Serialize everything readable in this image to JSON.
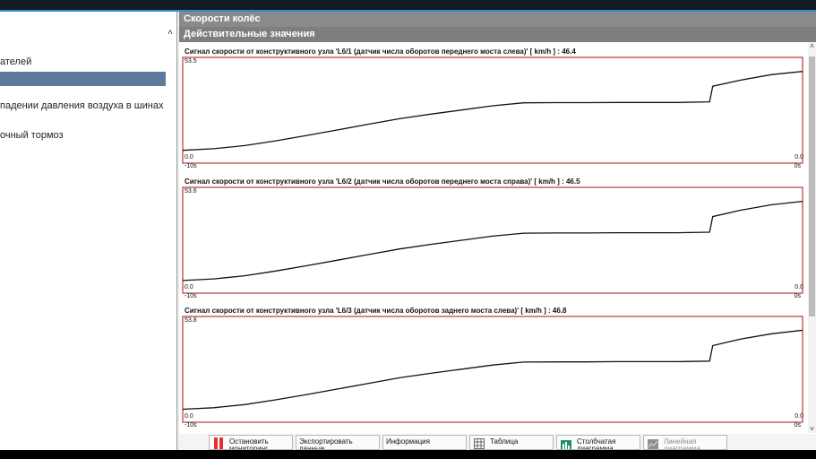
{
  "left_pane": {
    "items": [
      {
        "label": "ателей",
        "selected": false
      },
      {
        "label": "",
        "selected": true
      },
      {
        "label": "падении давления воздуха в шинах",
        "selected": false
      },
      {
        "label": "очный тормоз",
        "selected": false
      }
    ],
    "collapse_icon": "chevron-up-icon"
  },
  "header": {
    "title": "Скорости колёс",
    "subtitle": "Действительные значения"
  },
  "charts": [
    {
      "title": "Сигнал скорости от конструктивного узла 'L6/1 (датчик числа оборотов переднего моста слева)' [ km/h ] : 46.4",
      "y_top_label": "53.5",
      "y_bottom_label": "0.0",
      "right_bottom_label": "0.0",
      "x_left_label": "-10s",
      "x_right_label": "0s"
    },
    {
      "title": "Сигнал скорости от конструктивного узла 'L6/2 (датчик числа оборотов переднего моста справа)' [ km/h ] : 46.5",
      "y_top_label": "53.6",
      "y_bottom_label": "0.0",
      "right_bottom_label": "0.0",
      "x_left_label": "-10s",
      "x_right_label": "0s"
    },
    {
      "title": "Сигнал скорости от конструктивного узла 'L6/3 (датчик числа оборотов заднего моста слева)' [ km/h ] : 46.8",
      "y_top_label": "53.8",
      "y_bottom_label": "0.0",
      "right_bottom_label": "0.0",
      "x_left_label": "-10s",
      "x_right_label": "0s"
    }
  ],
  "chart_data": [
    {
      "type": "line",
      "title": "Сигнал скорости от конструктивного узла 'L6/1 (датчик числа оборотов переднего моста слева)' [ km/h ] : 46.4",
      "xlabel": "",
      "ylabel": "",
      "xlim": [
        -10,
        0
      ],
      "ylim": [
        0.0,
        53.5
      ],
      "x": [
        -10,
        -9.5,
        -9,
        -8.5,
        -8,
        -7.5,
        -7,
        -6.5,
        -6,
        -5.5,
        -5,
        -4.5,
        -4,
        -3.5,
        -3,
        -2.5,
        -2,
        -1.5,
        -1.45,
        -1.0,
        -0.5,
        0
      ],
      "y": [
        6.5,
        7.3,
        8.9,
        11.3,
        14.0,
        16.8,
        19.7,
        22.5,
        24.8,
        26.9,
        29.0,
        30.5,
        30.6,
        30.6,
        30.7,
        30.7,
        30.7,
        31.0,
        38.9,
        42.0,
        44.8,
        46.4
      ]
    },
    {
      "type": "line",
      "title": "Сигнал скорости от конструктивного узла 'L6/2 (датчик числа оборотов переднего моста справа)' [ km/h ] : 46.5",
      "xlabel": "",
      "ylabel": "",
      "xlim": [
        -10,
        0
      ],
      "ylim": [
        0.0,
        53.6
      ],
      "x": [
        -10,
        -9.5,
        -9,
        -8.5,
        -8,
        -7.5,
        -7,
        -6.5,
        -6,
        -5.5,
        -5,
        -4.5,
        -4,
        -3.5,
        -3,
        -2.5,
        -2,
        -1.5,
        -1.45,
        -1.0,
        -0.5,
        0
      ],
      "y": [
        6.4,
        7.2,
        8.8,
        11.2,
        13.9,
        16.7,
        19.6,
        22.4,
        24.7,
        26.8,
        28.9,
        30.4,
        30.5,
        30.5,
        30.6,
        30.6,
        30.6,
        30.9,
        38.8,
        42.0,
        44.8,
        46.5
      ]
    },
    {
      "type": "line",
      "title": "Сигнал скорости от конструктивного узла 'L6/3 (датчик числа оборотов заднего моста слева)' [ km/h ] : 46.8",
      "xlabel": "",
      "ylabel": "",
      "xlim": [
        -10,
        0
      ],
      "ylim": [
        0.0,
        53.8
      ],
      "x": [
        -10,
        -9.5,
        -9,
        -8.5,
        -8,
        -7.5,
        -7,
        -6.5,
        -6,
        -5.5,
        -5,
        -4.5,
        -4,
        -3.5,
        -3,
        -2.5,
        -2,
        -1.5,
        -1.45,
        -1.0,
        -0.5,
        0
      ],
      "y": [
        6.6,
        7.4,
        9.0,
        11.4,
        14.1,
        16.9,
        19.8,
        22.6,
        24.9,
        27.0,
        29.1,
        30.6,
        30.7,
        30.7,
        30.8,
        30.8,
        30.8,
        31.1,
        39.0,
        42.3,
        45.0,
        46.8
      ]
    }
  ],
  "toolbar": {
    "buttons": [
      {
        "label": "Остановить мониторинг",
        "icon": "stop-icon",
        "enabled": true
      },
      {
        "label": "Экспортировать данные.",
        "icon": "",
        "enabled": true
      },
      {
        "label": "Информация",
        "icon": "",
        "enabled": true
      },
      {
        "label": "Таблица",
        "icon": "table-icon",
        "enabled": true
      },
      {
        "label": "Столбчатая диаграмма",
        "icon": "bar-chart-icon",
        "enabled": true
      },
      {
        "label": "Линейная диаграмма",
        "icon": "line-chart-icon",
        "enabled": false
      }
    ]
  },
  "colors": {
    "header_bg": "#8a8a8a",
    "chart_frame": "#b23a3a",
    "selected_nav": "#5b7a9e",
    "line": "#111111"
  }
}
